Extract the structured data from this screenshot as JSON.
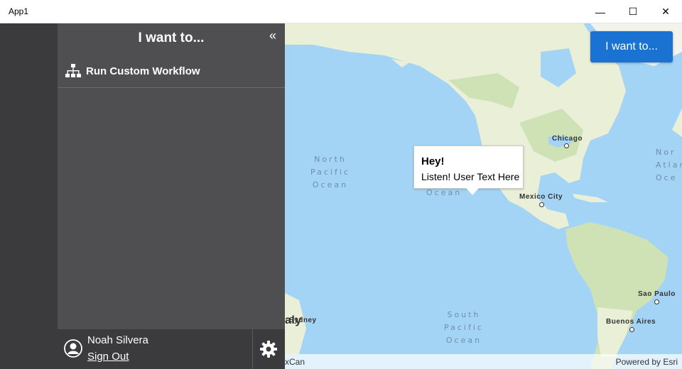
{
  "window": {
    "title": "App1",
    "minimize_glyph": "—",
    "maximize_glyph": "☐",
    "close_glyph": "✕"
  },
  "panel": {
    "title": "I want to...",
    "collapse_glyph": "«",
    "workflow_label": "Run Custom Workflow",
    "workflow_icon": "sitemap-icon"
  },
  "footer": {
    "user_name": "Noah Silvera",
    "sign_out_label": "Sign Out",
    "settings_icon": "gear-icon"
  },
  "map": {
    "oceans": [
      {
        "name": "north-pacific",
        "lines": [
          "North",
          "Pacific",
          "Ocean"
        ]
      },
      {
        "name": "south-pacific",
        "lines": [
          "South",
          "Pacific",
          "Ocean"
        ]
      },
      {
        "name": "north-atlantic",
        "lines": [
          "Nor",
          "Atlan",
          "Oce"
        ]
      }
    ],
    "partial_ocean_word": "Ocean",
    "cities": [
      "Chicago",
      "Mexico City",
      "Sao Paulo",
      "Buenos Aires",
      "Sydney"
    ],
    "partial_country": "aly",
    "callout": {
      "title": "Hey!",
      "text": "Listen! User Text Here"
    },
    "iwant_button": "I want to...",
    "attribution_left": "xCan",
    "attribution_right": "Powered by Esri"
  }
}
